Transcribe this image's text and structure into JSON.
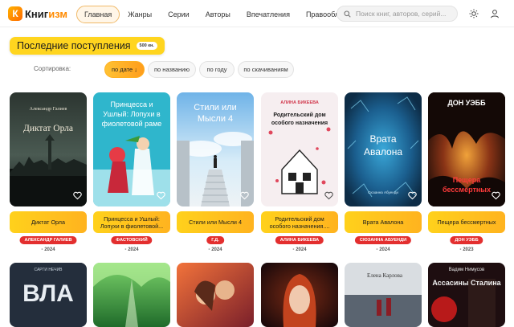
{
  "brand": {
    "logo_letter": "К",
    "name_a": "Книг",
    "name_b": "изм"
  },
  "nav": [
    {
      "label": "Главная",
      "active": true
    },
    {
      "label": "Жанры"
    },
    {
      "label": "Серии"
    },
    {
      "label": "Авторы"
    },
    {
      "label": "Впечатления"
    },
    {
      "label": "Правообладателям"
    }
  ],
  "search": {
    "placeholder": "Поиск книг, авторов, серий..."
  },
  "header_icons": [
    "sun-icon",
    "user-icon"
  ],
  "section": {
    "title": "Последние поступления",
    "badge": "500 кн."
  },
  "sort": {
    "label": "Сортировка:",
    "options": [
      "по дате ↓",
      "по названию",
      "по году",
      "по скачиваниям"
    ],
    "active_index": 0
  },
  "books": [
    {
      "title": "Диктат Орла",
      "author": "АЛЕКСАНДР ГАЛИЕВ",
      "year": "2024",
      "cover_text": [
        "Александр Галиев",
        "Диктат Орла"
      ]
    },
    {
      "title": "Принцесса и Ушлый: Лопухи в фиолетовой...",
      "author": "ФАСТОВСКИЙ",
      "year": "2024",
      "cover_text": [
        "Принцесса и",
        "Ушлый: Лопухи в",
        "фиолетовой раме"
      ]
    },
    {
      "title": "Стили или Мысли 4",
      "author": "Г.Д.",
      "year": "2024",
      "cover_text": [
        "Стили или",
        "Мысли 4"
      ]
    },
    {
      "title": "Родительский дом особого назначения....",
      "author": "АЛИНА БИКЕЕВА",
      "year": "2024",
      "cover_text": [
        "АЛИНА БИКЕЕВА",
        "Родительский дом",
        "особого назначения"
      ]
    },
    {
      "title": "Врата Авалона",
      "author": "СЮЗАННА АБУЕНДИ",
      "year": "2024",
      "cover_text": [
        "Врата",
        "Авалона",
        "Сюзанна Абуенди"
      ]
    },
    {
      "title": "Пещера бессмертных",
      "author": "ДОН УЭББ",
      "year": "2023",
      "cover_text": [
        "ДОН УЭББ",
        "Пещера",
        "бессмертных"
      ]
    }
  ],
  "row2_cover_text": [
    {
      "top": "САРГИ НЕЧИВ",
      "main": "ВЛА"
    },
    {
      "top": "",
      "main": ""
    },
    {
      "top": "",
      "main": ""
    },
    {
      "top": "",
      "main": ""
    },
    {
      "top": "Елена Карлова",
      "main": ""
    },
    {
      "top": "Вадим Нимусов",
      "main": "Ассасины Сталина"
    }
  ],
  "colors": {
    "accent": "#ffb31f",
    "author_badge": "#e32f2f",
    "active_nav": "#fff6e8"
  }
}
